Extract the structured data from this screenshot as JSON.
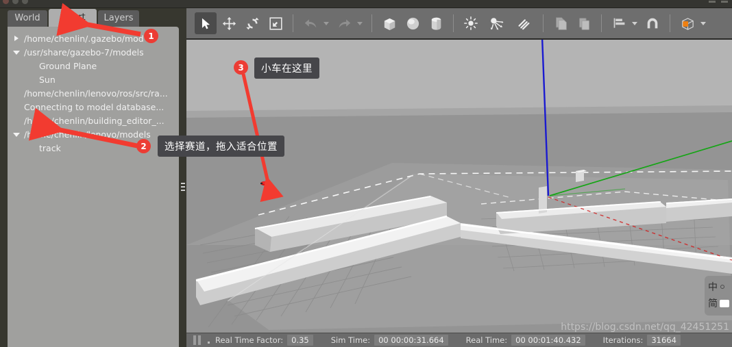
{
  "window": {
    "title_bar_buttons": [
      "close",
      "minimize",
      "maximize"
    ]
  },
  "left_panel": {
    "tabs": [
      {
        "label": "World",
        "active": false
      },
      {
        "label": "Insert",
        "active": true
      },
      {
        "label": "Layers",
        "active": false
      }
    ],
    "tree": [
      {
        "label": "/home/chenlin/.gazebo/mod",
        "state": "closed",
        "indent": 0
      },
      {
        "label": "/usr/share/gazebo-7/models",
        "state": "open",
        "indent": 0
      },
      {
        "label": "Ground Plane",
        "state": "leaf",
        "indent": 1
      },
      {
        "label": "Sun",
        "state": "leaf",
        "indent": 1
      },
      {
        "label": "/home/chenlin/lenovo/ros/src/ra...",
        "state": "none",
        "indent": 0
      },
      {
        "label": "Connecting to model database...",
        "state": "none",
        "indent": 0
      },
      {
        "label": "/home/chenlin/building_editor_...",
        "state": "none",
        "indent": 0
      },
      {
        "label": "/home/chenlin/lenovo/models",
        "state": "open",
        "indent": 0
      },
      {
        "label": "track",
        "state": "leaf",
        "indent": 1
      }
    ]
  },
  "toolbar": {
    "items": [
      {
        "name": "select-mode",
        "icon": "cursor-arrow",
        "active": true
      },
      {
        "name": "translate-mode",
        "icon": "move-arrows",
        "active": false
      },
      {
        "name": "rotate-mode",
        "icon": "rotate-arrows",
        "active": false
      },
      {
        "name": "scale-mode",
        "icon": "scale-arrows",
        "active": false
      },
      {
        "name": "undo",
        "icon": "undo-arrow",
        "active": false
      },
      {
        "name": "redo",
        "icon": "redo-arrow",
        "active": false
      },
      {
        "name": "insert-box",
        "icon": "box-shape",
        "active": false
      },
      {
        "name": "insert-sphere",
        "icon": "sphere-shape",
        "active": false
      },
      {
        "name": "insert-cylinder",
        "icon": "cylinder-shape",
        "active": false
      },
      {
        "name": "insert-point-light",
        "icon": "point-light",
        "active": false
      },
      {
        "name": "insert-spot-light",
        "icon": "spot-light",
        "active": false
      },
      {
        "name": "insert-directional-light",
        "icon": "directional-light",
        "active": false
      },
      {
        "name": "copy",
        "icon": "copy-pages",
        "active": false
      },
      {
        "name": "paste",
        "icon": "paste-clipboard",
        "active": false
      },
      {
        "name": "align",
        "icon": "align-bars",
        "active": false
      },
      {
        "name": "snap",
        "icon": "magnet",
        "active": false
      },
      {
        "name": "view-angle",
        "icon": "wire-cube-orange",
        "active": false
      }
    ]
  },
  "viewport": {
    "scene_name": "gazebo-3d-scene",
    "colors": {
      "sky": "#b4b4b4",
      "ground": "#949494",
      "track_wall": "#cfcfcf",
      "axis_z": "#1a1ad0",
      "axis_y": "#1aa01a",
      "car": "#d01010"
    }
  },
  "status_bar": {
    "real_time_factor_label": "Real Time Factor:",
    "real_time_factor_value": "0.35",
    "sim_time_label": "Sim Time:",
    "sim_time_value": "00 00:00:31.664",
    "real_time_label": "Real Time:",
    "real_time_value": "00 00:01:40.432",
    "iterations_label": "Iterations:",
    "iterations_value": "31664"
  },
  "annotations": [
    {
      "badge": "1",
      "text": null
    },
    {
      "badge": "2",
      "text": "选择赛道，拖入适合位置"
    },
    {
      "badge": "3",
      "text": "小车在这里"
    }
  ],
  "annotation_labels": {
    "track_hint": "选择赛道，拖入适合位置",
    "car_hint": "小车在这里"
  },
  "ime": {
    "mode_char": "中",
    "script_char": "简"
  },
  "watermark": {
    "text": "https://blog.csdn.net/qq_42451251"
  }
}
